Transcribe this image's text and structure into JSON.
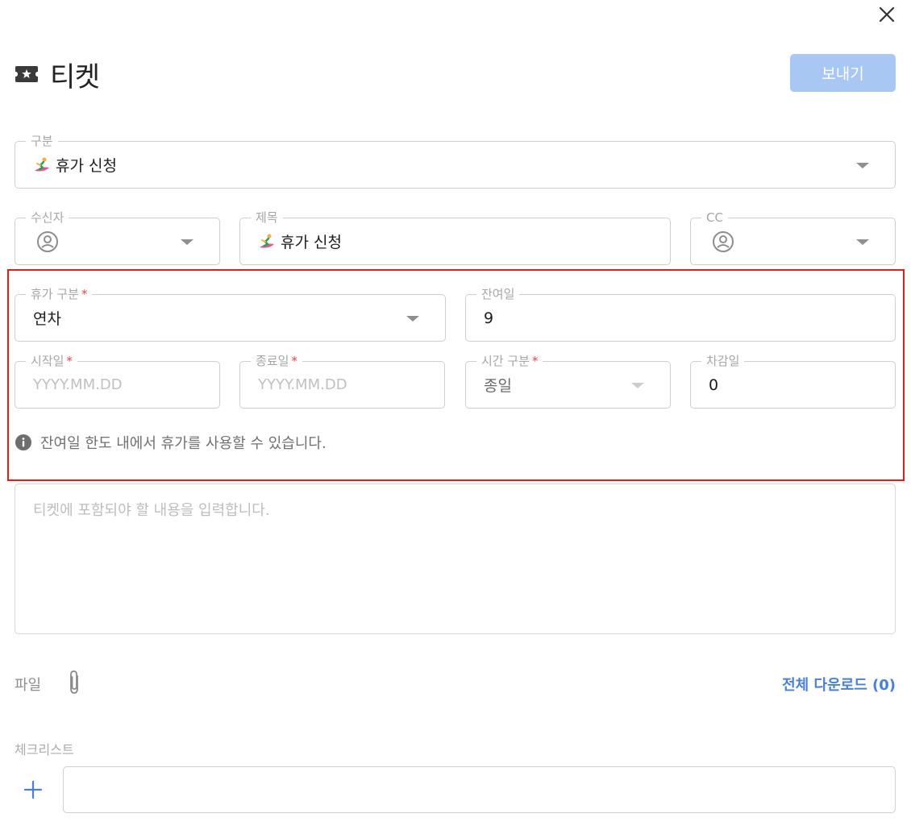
{
  "header": {
    "title": "티켓",
    "send_label": "보내기",
    "title_icon": "ticket-star-icon",
    "close_icon": "close-icon"
  },
  "category": {
    "label": "구분",
    "value": "휴가 신청",
    "emoji": "surfer-emoji"
  },
  "recipient": {
    "label": "수신자",
    "icon": "user-avatar-icon"
  },
  "subject": {
    "label": "제목",
    "value": "휴가 신청",
    "emoji": "surfer-emoji"
  },
  "cc": {
    "label": "CC",
    "icon": "user-avatar-icon"
  },
  "leave": {
    "type_label": "휴가 구분",
    "type_value": "연차",
    "remaining_label": "잔여일",
    "remaining_value": "9",
    "start_label": "시작일",
    "start_placeholder": "YYYY.MM.DD",
    "end_label": "종료일",
    "end_placeholder": "YYYY.MM.DD",
    "time_label": "시간 구분",
    "time_value": "종일",
    "deduct_label": "차감일",
    "deduct_value": "0",
    "required_mark": "*",
    "info_text": "잔여일 한도 내에서 휴가를 사용할 수 있습니다."
  },
  "content": {
    "placeholder": "티켓에 포함되야 할 내용을 입력합니다."
  },
  "files": {
    "label": "파일",
    "download_all": "전체 다운로드 (0)"
  },
  "checklist": {
    "label": "체크리스트"
  },
  "colors": {
    "primary_button": "#a9c7f3",
    "link": "#4a7fd9",
    "highlight": "#e81b1b",
    "required": "#e5484d"
  }
}
